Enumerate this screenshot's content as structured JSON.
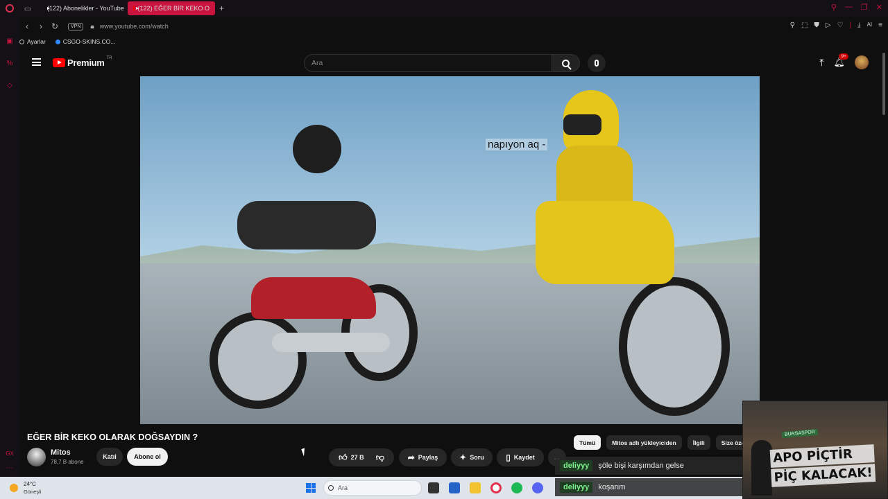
{
  "browser": {
    "tabs": [
      {
        "label": "(122) Abonelikler - YouTube",
        "active": false
      },
      {
        "label": "(122) EĞER BİR KEKO O",
        "active": true
      }
    ],
    "url": "www.youtube.com/watch",
    "vpn_label": "VPN",
    "ai_label": "AI",
    "bookmarks": [
      {
        "label": "Ayarlar",
        "icon": "gear-icon"
      },
      {
        "label": "CSGO-SKINS.CO...",
        "icon": "globe-icon"
      }
    ]
  },
  "youtube": {
    "logo_text": "Premium",
    "region": "TR",
    "search_placeholder": "Ara",
    "notification_count": "9+"
  },
  "video": {
    "caption": "napıyon aq -",
    "title": "EĞER BİR KEKO OLARAK DOĞSAYDIN ?",
    "channel": "Mitos",
    "subscribers": "78,7 B abone",
    "join_label": "Katıl",
    "subscribe_label": "Abone ol",
    "likes": "27 B",
    "share_label": "Paylaş",
    "ask_label": "Soru",
    "save_label": "Kaydet",
    "more_label": "..."
  },
  "chips": [
    {
      "label": "Tümü",
      "selected": true
    },
    {
      "label": "Mitos adlı yükleyiciden",
      "selected": false
    },
    {
      "label": "İlgili",
      "selected": false
    },
    {
      "label": "Size öze",
      "selected": false
    }
  ],
  "chat": [
    {
      "user": "deliyyy",
      "message": "şöle bişi karşımdan gelse"
    },
    {
      "user": "deliyyy",
      "message": "koşarım"
    }
  ],
  "stream_overlay": {
    "sign": "BURSASPOR",
    "line1": "APO PİÇTİR",
    "line2": "PİÇ KALACAK!"
  },
  "taskbar": {
    "temperature": "24°C",
    "weather": "Güneşli",
    "search_placeholder": "Ara"
  },
  "colors": {
    "accent": "#c8143f",
    "youtube_red": "#ff0000",
    "chat_user": "#7cf28c"
  }
}
